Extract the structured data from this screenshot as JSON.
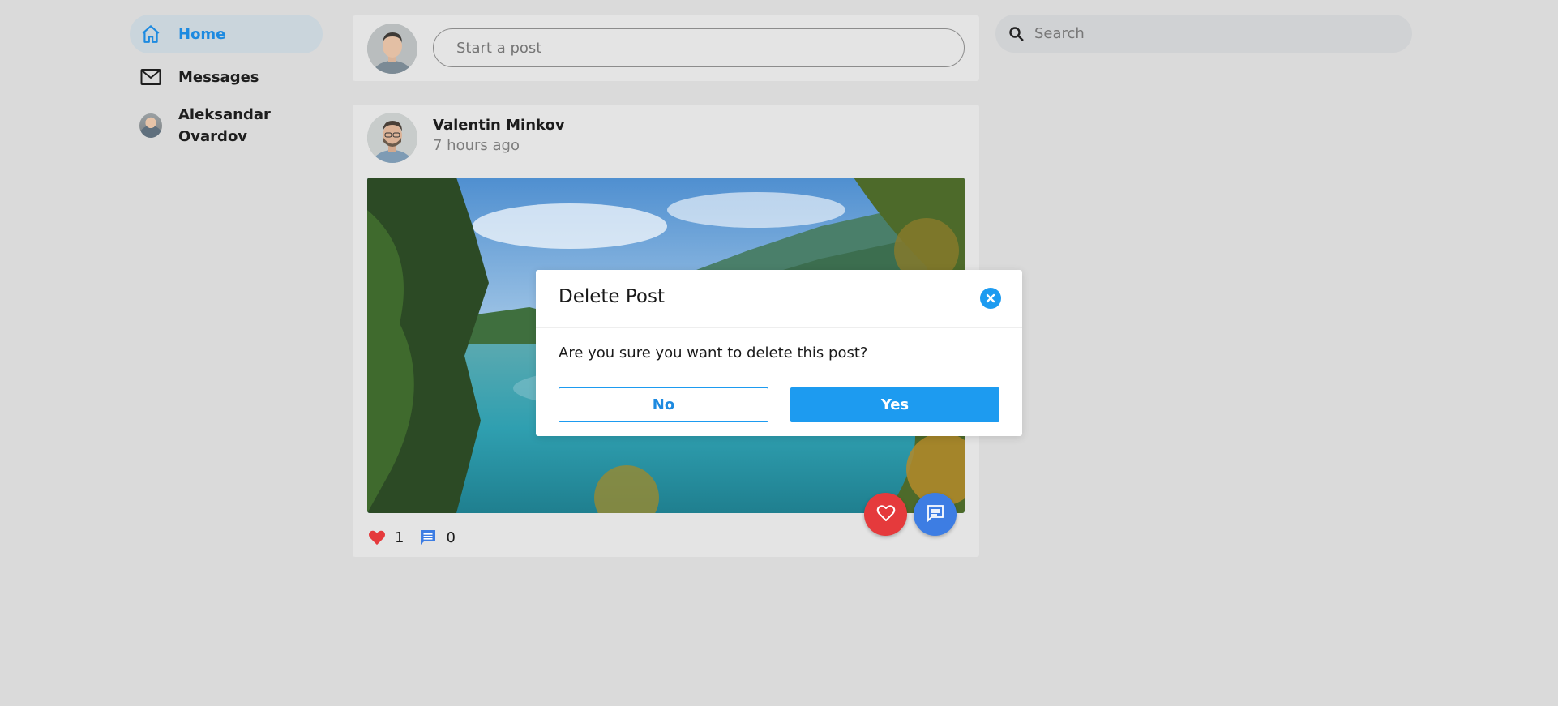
{
  "sidebar": {
    "items": [
      {
        "label": "Home",
        "icon": "home-icon",
        "active": true
      },
      {
        "label": "Messages",
        "icon": "mail-icon",
        "active": false
      },
      {
        "label": "Aleksandar Ovardov",
        "icon": "avatar",
        "active": false
      }
    ]
  },
  "composer": {
    "placeholder": "Start a post"
  },
  "search": {
    "placeholder": "Search"
  },
  "post": {
    "author": "Valentin Minkov",
    "time": "7 hours ago",
    "likes": "1",
    "comments": "0"
  },
  "modal": {
    "title": "Delete Post",
    "message": "Are you sure you want to delete this post?",
    "no_label": "No",
    "yes_label": "Yes"
  },
  "colors": {
    "accent": "#1d9bf0",
    "like": "#e53a3c",
    "comment": "#3d7de3",
    "background": "#dadada"
  }
}
